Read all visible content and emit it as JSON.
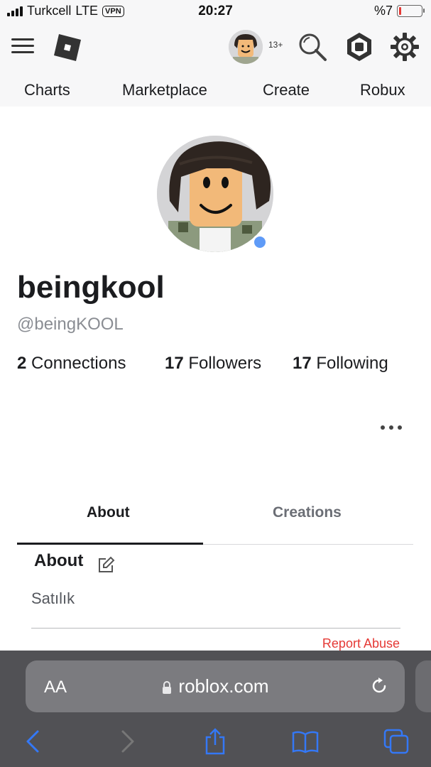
{
  "status_bar": {
    "carrier": "Turkcell",
    "network": "LTE",
    "vpn": "VPN",
    "time": "20:27",
    "battery": "%7"
  },
  "header": {
    "age_badge": "13+"
  },
  "nav": {
    "items": [
      "Charts",
      "Marketplace",
      "Create",
      "Robux"
    ]
  },
  "profile": {
    "display_name": "beingkool",
    "username": "@beingKOOL",
    "connections": {
      "count": "2",
      "label": "Connections"
    },
    "followers": {
      "count": "17",
      "label": "Followers"
    },
    "following": {
      "count": "17",
      "label": "Following"
    }
  },
  "tabs": {
    "about": "About",
    "creations": "Creations",
    "active": "About"
  },
  "about": {
    "heading": "About",
    "text": "Satılık",
    "report": "Report Abuse"
  },
  "safari": {
    "aa": "AA",
    "url": "roblox.com"
  },
  "colors": {
    "accent_blue": "#3478f6",
    "online_dot": "#5f9bf7",
    "report_red": "#e53935"
  }
}
